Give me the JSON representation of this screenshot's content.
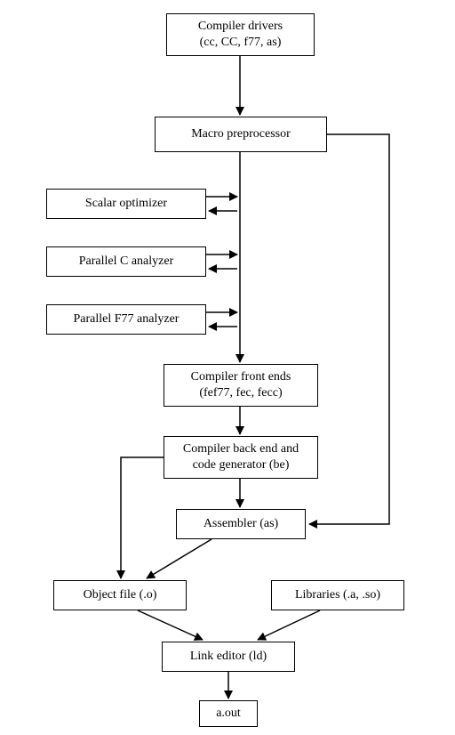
{
  "nodes": {
    "drivers": {
      "line1": "Compiler drivers",
      "line2": "(cc, CC, f77, as)"
    },
    "macro": {
      "line1": "Macro preprocessor"
    },
    "scalar": {
      "line1": "Scalar optimizer"
    },
    "parc": {
      "line1": "Parallel C analyzer"
    },
    "parf77": {
      "line1": "Parallel F77 analyzer"
    },
    "frontends": {
      "line1": "Compiler front ends",
      "line2": "(fef77, fec, fecc)"
    },
    "backend": {
      "line1": "Compiler back end and",
      "line2": "code generator (be)"
    },
    "assembler": {
      "line1": "Assembler (as)"
    },
    "objfile": {
      "line1": "Object file (.o)"
    },
    "libraries": {
      "line1": "Libraries (.a, .so)"
    },
    "linkeditor": {
      "line1": "Link editor (ld)"
    },
    "aout": {
      "line1": "a.out"
    }
  }
}
